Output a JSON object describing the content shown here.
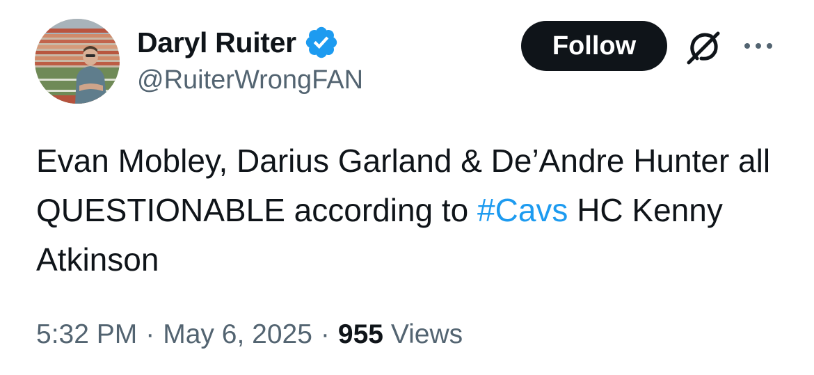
{
  "author": {
    "display_name": "Daryl Ruiter",
    "handle": "@RuiterWrongFAN",
    "verified": true,
    "avatar_icon": "profile-photo-stadium"
  },
  "actions": {
    "follow_label": "Follow",
    "grok_icon": "grok-icon",
    "more_icon": "more-horizontal-icon"
  },
  "tweet": {
    "text_before": "Evan Mobley, Darius Garland & De’Andre Hunter all QUESTIONABLE according to ",
    "hashtag": "#Cavs",
    "text_after": " HC Kenny Atkinson"
  },
  "meta": {
    "time": "5:32 PM",
    "separator": "·",
    "date": "May 6, 2025",
    "views_count": "955",
    "views_label": "Views"
  },
  "colors": {
    "text": "#0f1419",
    "secondary": "#536471",
    "link": "#1d9bf0",
    "verified": "#1d9bf0",
    "follow_bg": "#0f1419",
    "follow_text": "#ffffff"
  }
}
